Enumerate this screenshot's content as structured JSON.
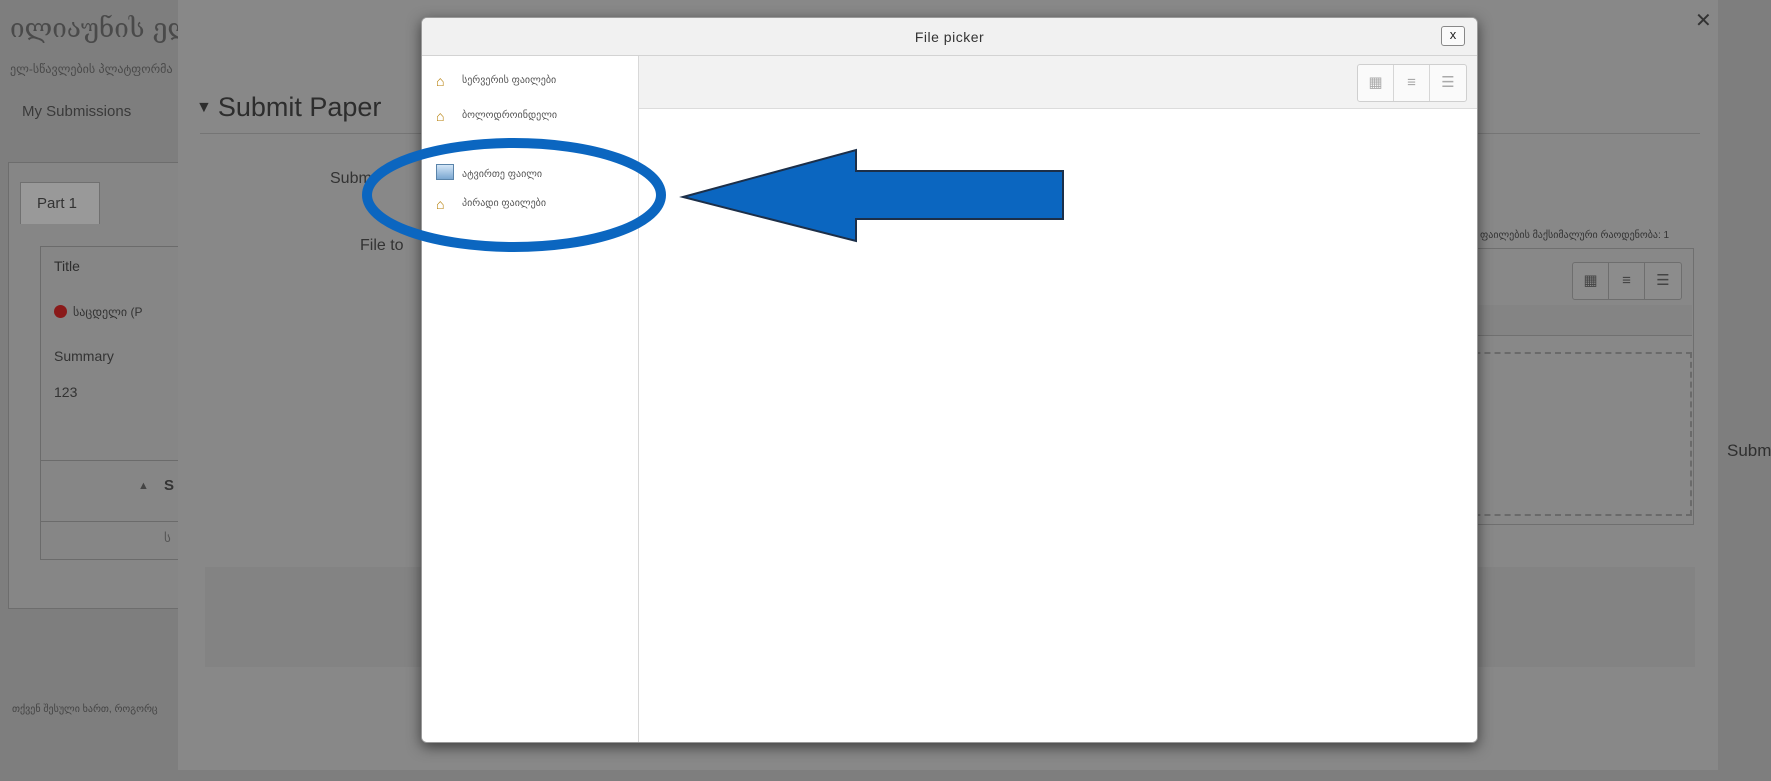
{
  "background": {
    "heading": "ილიაუნის ელ",
    "subheading": "ელ-სწავლების პლატფორმა",
    "my_submissions": "My Submissions",
    "tab_part1": "Part 1",
    "table_title": "Title",
    "row1_text": "საცდელი (P",
    "summary_label": "Summary",
    "summary_value": "123",
    "sort_letter": "S",
    "l_letter": "ს",
    "footer": "თქვენ შესული ხართ, როგორც"
  },
  "submit_dialog": {
    "title": "Submit Paper",
    "submission_label": "Subm",
    "file_to_label": "File to",
    "max_files_text": "ფაილების მაქსიმალური რაოდენობა: 1",
    "submit_button": "Subm"
  },
  "file_picker": {
    "title": "File picker",
    "close": "x",
    "repositories": [
      {
        "label": "სერვერის ფაილები",
        "icon": "home-icon"
      },
      {
        "label": "ბოლოდროინდელი",
        "icon": "home-icon"
      },
      {
        "label": "ატვირთე ფაილი",
        "icon": "upload-icon"
      },
      {
        "label": "პირადი ფაილები",
        "icon": "home-icon"
      }
    ]
  },
  "annotation": {
    "ellipse_color": "#0b66c0",
    "arrow_color": "#0b66c0"
  }
}
